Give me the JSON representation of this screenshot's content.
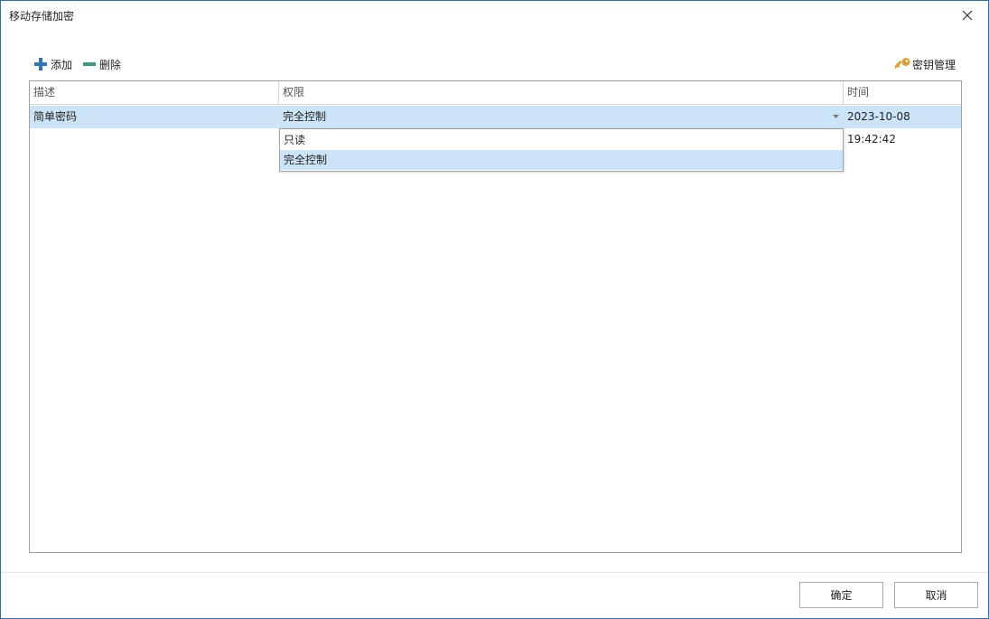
{
  "window": {
    "title": "移动存储加密"
  },
  "toolbar": {
    "add_label": "添加",
    "delete_label": "删除",
    "key_manage_label": "密钥管理"
  },
  "grid": {
    "columns": [
      "描述",
      "权限",
      "时间"
    ],
    "rows": [
      {
        "description": "简单密码",
        "permission": "完全控制",
        "time": "2023-10-08 19:42:42"
      }
    ]
  },
  "permission_dropdown": {
    "options": [
      "只读",
      "完全控制"
    ],
    "selected": "完全控制"
  },
  "footer": {
    "ok_label": "确定",
    "cancel_label": "取消"
  },
  "colors": {
    "accent_plus": "#2e75b6",
    "minus": "#3a9b7a",
    "key": "#e0a030",
    "selection": "#cce4f7",
    "window_border": "#2b6cb0"
  },
  "icons": [
    "close-icon",
    "plus-icon",
    "minus-icon",
    "key-icon",
    "dropdown-arrow-icon"
  ]
}
